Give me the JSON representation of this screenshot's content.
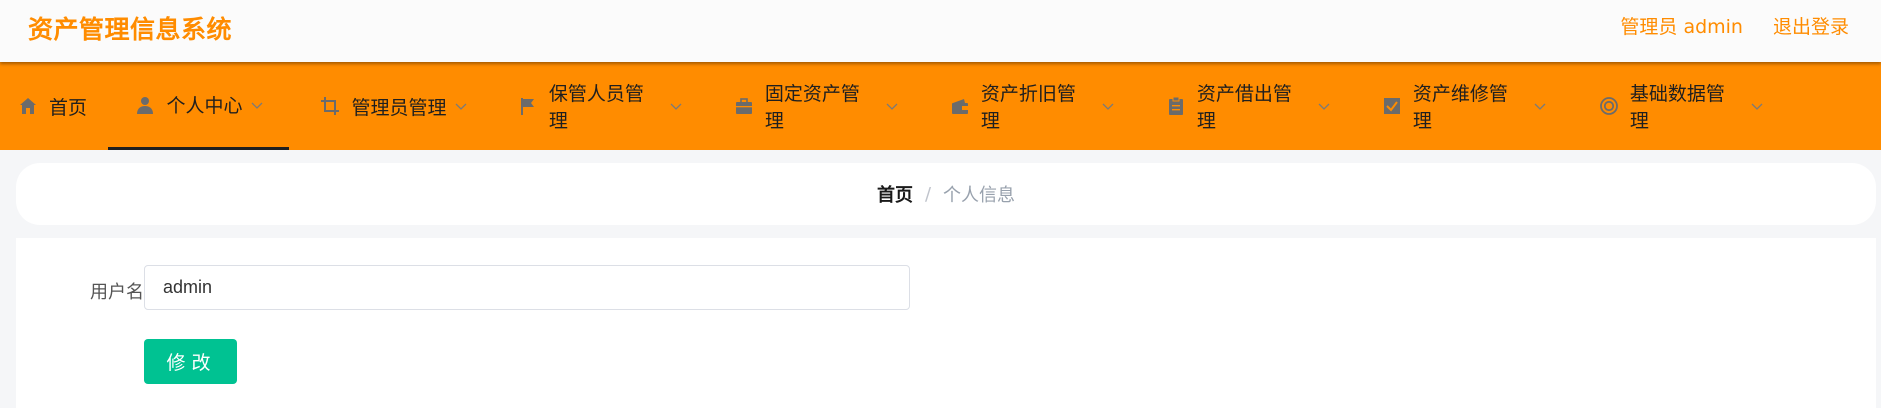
{
  "header": {
    "title": "资产管理信息系统",
    "user_label": "管理员 admin",
    "logout_label": "退出登录"
  },
  "colors": {
    "brand": "#ff8c00",
    "nav_bg": "#ff8c00",
    "primary_button": "#00c292"
  },
  "nav": {
    "items": [
      {
        "label": "首页",
        "icon": "home-icon"
      },
      {
        "label": "个人中心",
        "icon": "user-icon",
        "active": true
      },
      {
        "label": "管理员管理",
        "icon": "crop-icon"
      },
      {
        "label": "保管人员管理",
        "icon": "flag-icon"
      },
      {
        "label": "固定资产管理",
        "icon": "briefcase-icon"
      },
      {
        "label": "资产折旧管理",
        "icon": "wallet-icon"
      },
      {
        "label": "资产借出管理",
        "icon": "clipboard-icon"
      },
      {
        "label": "资产维修管理",
        "icon": "check-square-icon"
      },
      {
        "label": "基础数据管理",
        "icon": "target-icon"
      }
    ]
  },
  "breadcrumb": {
    "home": "首页",
    "separator": "/",
    "current": "个人信息"
  },
  "form": {
    "username_label": "用户名",
    "username_value": "admin",
    "submit_label": "修改"
  }
}
